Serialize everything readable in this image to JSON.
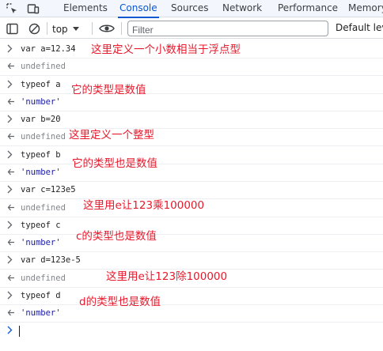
{
  "tabs": [
    {
      "label": "Elements"
    },
    {
      "label": "Console"
    },
    {
      "label": "Sources"
    },
    {
      "label": "Network"
    },
    {
      "label": "Performance"
    },
    {
      "label": "Memory"
    }
  ],
  "active_tab": "Console",
  "toolbar": {
    "context": "top",
    "filter_placeholder": "Filter",
    "levels": "Default levels"
  },
  "rows": [
    {
      "kind": "input",
      "code": "var a=12.34"
    },
    {
      "kind": "output",
      "code": "undefined"
    },
    {
      "kind": "input",
      "code": "typeof a"
    },
    {
      "kind": "output",
      "code": "'number'"
    },
    {
      "kind": "input",
      "code": "var b=20"
    },
    {
      "kind": "output",
      "code": "undefined"
    },
    {
      "kind": "input",
      "code": "typeof b"
    },
    {
      "kind": "output",
      "code": "'number'"
    },
    {
      "kind": "input",
      "code": "var c=123e5"
    },
    {
      "kind": "output",
      "code": "undefined"
    },
    {
      "kind": "input",
      "code": "typeof c"
    },
    {
      "kind": "output",
      "code": "'number'"
    },
    {
      "kind": "input",
      "code": "var d=123e-5"
    },
    {
      "kind": "output",
      "code": "undefined"
    },
    {
      "kind": "input",
      "code": "typeof d"
    },
    {
      "kind": "output",
      "code": "'number'"
    }
  ],
  "annotations": [
    "这里定义一个小数相当于浮点型",
    "它的类型是数值",
    "这里定义一个整型",
    "它的类型也是数值",
    "这里用e让123乘100000",
    "c的类型也是数值",
    "这里用e让123除100000",
    "d的类型也是数值"
  ],
  "colors": {
    "accent": "#0b57d0",
    "annotation": "#e8192c",
    "string": "#1a1aa6",
    "undefined": "#80868b"
  },
  "icons": {
    "inspect": "inspect-element-icon",
    "device": "device-toolbar-icon",
    "sidebar": "sidebar-toggle-icon",
    "clear": "clear-console-icon",
    "eye": "live-expression-eye-icon",
    "input_chevron": "chevron-right-icon",
    "output_chevron": "return-arrow-icon"
  }
}
